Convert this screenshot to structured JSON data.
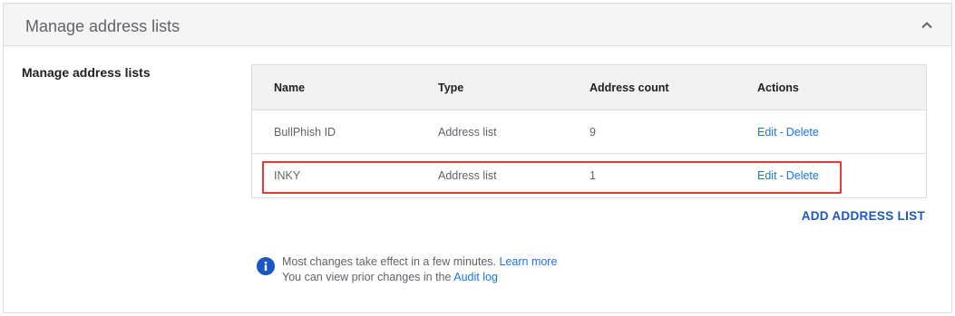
{
  "panel": {
    "title": "Manage address lists"
  },
  "section": {
    "label": "Manage address lists"
  },
  "table": {
    "headers": {
      "name": "Name",
      "type": "Type",
      "count": "Address count",
      "actions": "Actions"
    },
    "rows": [
      {
        "name": "BullPhish ID",
        "type": "Address list",
        "count": "9",
        "edit": "Edit",
        "sep": "-",
        "delete": "Delete"
      },
      {
        "name": "INKY",
        "type": "Address list",
        "count": "1",
        "edit": "Edit",
        "sep": "-",
        "delete": "Delete"
      }
    ]
  },
  "actions": {
    "add_label": "ADD ADDRESS LIST"
  },
  "info": {
    "line1_text": "Most changes take effect in a few minutes.",
    "line1_link": "Learn more",
    "line2_text": "You can view prior changes in the",
    "line2_link": "Audit log"
  },
  "icons": {
    "collapse": "chevron-up-icon",
    "info": "info-icon"
  },
  "colors": {
    "link": "#1a73e8",
    "highlight": "#e53935",
    "info_icon": "#1a56c4"
  }
}
